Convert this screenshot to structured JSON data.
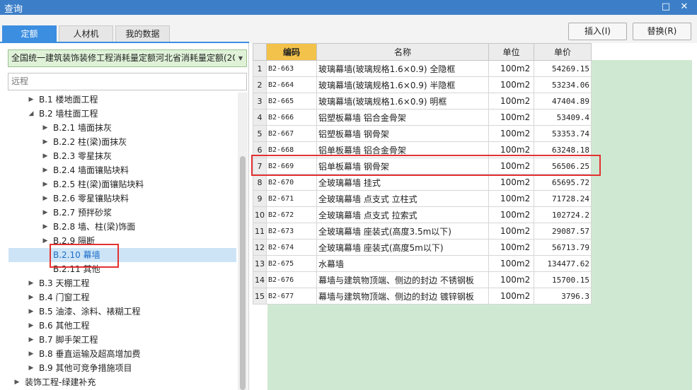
{
  "window": {
    "title": "查询",
    "maximize_glyph": "□",
    "close_glyph": "✕"
  },
  "tabs": [
    {
      "label": "定额",
      "active": true
    },
    {
      "label": "人材机",
      "active": false
    },
    {
      "label": "我的数据",
      "active": false
    }
  ],
  "actions": {
    "insert_label": "插入(I)",
    "replace_label": "替换(R)"
  },
  "sidebar": {
    "quota_select": "全国统一建筑装饰装修工程消耗量定额河北省消耗量定额(20",
    "search_value": "远程",
    "tree": [
      {
        "label": "B.1 楼地面工程",
        "level": 1,
        "toggle": "▶"
      },
      {
        "label": "B.2 墙柱面工程",
        "level": 1,
        "toggle": "◢"
      },
      {
        "label": "B.2.1 墙面抹灰",
        "level": 2,
        "toggle": "▶"
      },
      {
        "label": "B.2.2 柱(梁)面抹灰",
        "level": 2,
        "toggle": "▶"
      },
      {
        "label": "B.2.3 零星抹灰",
        "level": 2,
        "toggle": "▶"
      },
      {
        "label": "B.2.4 墙面镶贴块料",
        "level": 2,
        "toggle": "▶"
      },
      {
        "label": "B.2.5 柱(梁)面镶贴块料",
        "level": 2,
        "toggle": "▶"
      },
      {
        "label": "B.2.6 零星镶贴块料",
        "level": 2,
        "toggle": "▶"
      },
      {
        "label": "B.2.7 预拌砂浆",
        "level": 2,
        "toggle": "▶"
      },
      {
        "label": "B.2.8 墙、柱(梁)饰面",
        "level": 2,
        "toggle": "▶"
      },
      {
        "label": "B.2.9 隔断",
        "level": 2,
        "toggle": "▶"
      },
      {
        "label": "B.2.10 幕墙",
        "level": 2,
        "toggle": "",
        "selected": true
      },
      {
        "label": "B.2.11 其他",
        "level": 2,
        "toggle": ""
      },
      {
        "label": "B.3 天棚工程",
        "level": 1,
        "toggle": "▶"
      },
      {
        "label": "B.4 门窗工程",
        "level": 1,
        "toggle": "▶"
      },
      {
        "label": "B.5 油漆、涂料、裱糊工程",
        "level": 1,
        "toggle": "▶"
      },
      {
        "label": "B.6 其他工程",
        "level": 1,
        "toggle": "▶"
      },
      {
        "label": "B.7 脚手架工程",
        "level": 1,
        "toggle": "▶"
      },
      {
        "label": "B.8 垂直运输及超高增加费",
        "level": 1,
        "toggle": "▶"
      },
      {
        "label": "B.9 其他可竞争措施项目",
        "level": 1,
        "toggle": "▶"
      },
      {
        "label": "装饰工程-绿建补充",
        "level": 0,
        "toggle": "▶"
      }
    ]
  },
  "table": {
    "columns": [
      "编码",
      "名称",
      "单位",
      "单价"
    ],
    "rows": [
      {
        "no": "1",
        "code": "B2-663",
        "name": "玻璃幕墙(玻璃规格1.6×0.9) 全隐框",
        "unit": "100m2",
        "price": "54269.15"
      },
      {
        "no": "2",
        "code": "B2-664",
        "name": "玻璃幕墙(玻璃规格1.6×0.9) 半隐框",
        "unit": "100m2",
        "price": "53234.06"
      },
      {
        "no": "3",
        "code": "B2-665",
        "name": "玻璃幕墙(玻璃规格1.6×0.9) 明框",
        "unit": "100m2",
        "price": "47404.89"
      },
      {
        "no": "4",
        "code": "B2-666",
        "name": "铝塑板幕墙 铝合金骨架",
        "unit": "100m2",
        "price": "53409.4"
      },
      {
        "no": "5",
        "code": "B2-667",
        "name": "铝塑板幕墙 钢骨架",
        "unit": "100m2",
        "price": "53353.74"
      },
      {
        "no": "6",
        "code": "B2-668",
        "name": "铝单板幕墙 铝合金骨架",
        "unit": "100m2",
        "price": "63248.18"
      },
      {
        "no": "7",
        "code": "B2-669",
        "name": "铝单板幕墙 钢骨架",
        "unit": "100m2",
        "price": "56506.25"
      },
      {
        "no": "8",
        "code": "B2-670",
        "name": "全玻璃幕墙 挂式",
        "unit": "100m2",
        "price": "65695.72"
      },
      {
        "no": "9",
        "code": "B2-671",
        "name": "全玻璃幕墙 点支式 立柱式",
        "unit": "100m2",
        "price": "71728.24"
      },
      {
        "no": "10",
        "code": "B2-672",
        "name": "全玻璃幕墙 点支式 拉索式",
        "unit": "100m2",
        "price": "102724.2"
      },
      {
        "no": "11",
        "code": "B2-673",
        "name": "全玻璃幕墙 座装式(高度3.5m以下)",
        "unit": "100m2",
        "price": "29087.57"
      },
      {
        "no": "12",
        "code": "B2-674",
        "name": "全玻璃幕墙 座装式(高度5m以下)",
        "unit": "100m2",
        "price": "56713.79"
      },
      {
        "no": "13",
        "code": "B2-675",
        "name": "水幕墙",
        "unit": "100m2",
        "price": "134477.62"
      },
      {
        "no": "14",
        "code": "B2-676",
        "name": "幕墙与建筑物顶端、侧边的封边 不锈钢板",
        "unit": "100m2",
        "price": "15700.15"
      },
      {
        "no": "15",
        "code": "B2-677",
        "name": "幕墙与建筑物顶端、侧边的封边 镀锌钢板",
        "unit": "100m2",
        "price": "3796.3"
      }
    ]
  },
  "colors": {
    "title_bar": "#3c7fc8",
    "active_tab": "#3c8ee0",
    "header_highlight": "#f3c24a",
    "combo_bg": "#dff2d8",
    "empty_area": "#cfe8d2",
    "highlight_box": "#e33232"
  }
}
